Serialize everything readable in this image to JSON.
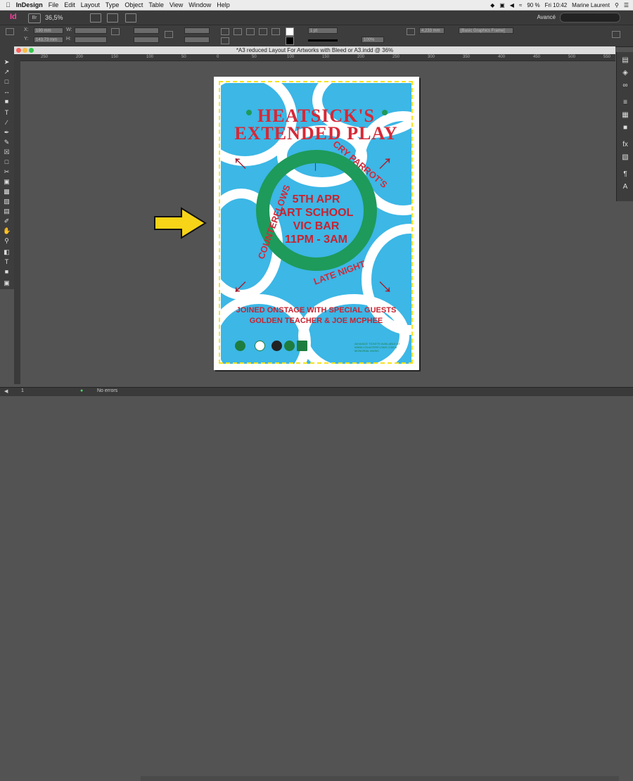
{
  "menubar": {
    "apple": "",
    "app": "InDesign",
    "items": [
      "File",
      "Edit",
      "Layout",
      "Type",
      "Object",
      "Table",
      "View",
      "Window",
      "Help"
    ],
    "battery": "90 %",
    "clock": "Fri 10:42",
    "user": "Marine Laurent"
  },
  "appbar": {
    "logo": "Id",
    "bridge": "Br",
    "zoom": "36,5%",
    "workspace": "Avancé"
  },
  "control": {
    "x_label": "X:",
    "y_label": "Y:",
    "w_label": "W:",
    "h_label": "H:",
    "x_value": "190 mm",
    "y_value": "143,73 mm",
    "stroke_weight": "1 pt",
    "opacity": "100%",
    "ref_value": "4,233 mm",
    "style_value": "[Basic Graphics Frame]"
  },
  "document": {
    "tab_title": "*A3 reduced Layout For Artworks with Bleed or A3.indd @ 36%"
  },
  "ruler": {
    "ticks": [
      "250",
      "200",
      "150",
      "100",
      "50",
      "0",
      "50",
      "100",
      "150",
      "200",
      "250",
      "300",
      "350",
      "400",
      "450",
      "500",
      "550"
    ]
  },
  "poster": {
    "title_line1": "HEATSICK'S",
    "title_line2": "EXTENDED PLAY",
    "ring_top": "CRY PARROT'S",
    "ring_left": "COUNTERFLOWS",
    "ring_bottom": "LATE NIGHT",
    "center_lines": [
      "5TH APR",
      "ART SCHOOL",
      "VIC BAR",
      "11PM - 3AM"
    ],
    "guests_line1": "JOINED ONSTAGE WITH SPECIAL GUESTS",
    "guests_line2": "GOLDEN TEACHER & JOE MCPHEE",
    "footer_small": "ADVANCE TICKETS AVAILABLE AT WWW.COUNTERFLOWS.COM & MONORAIL MUSIC"
  },
  "statusbar": {
    "page": "1",
    "errors": "No errors"
  },
  "colors": {
    "poster_blue": "#3cb7e6",
    "poster_red": "#d62836",
    "poster_green": "#1e9a5a",
    "bleed_yellow": "#f7e11b",
    "indesign_pink": "#ff3fa4"
  }
}
